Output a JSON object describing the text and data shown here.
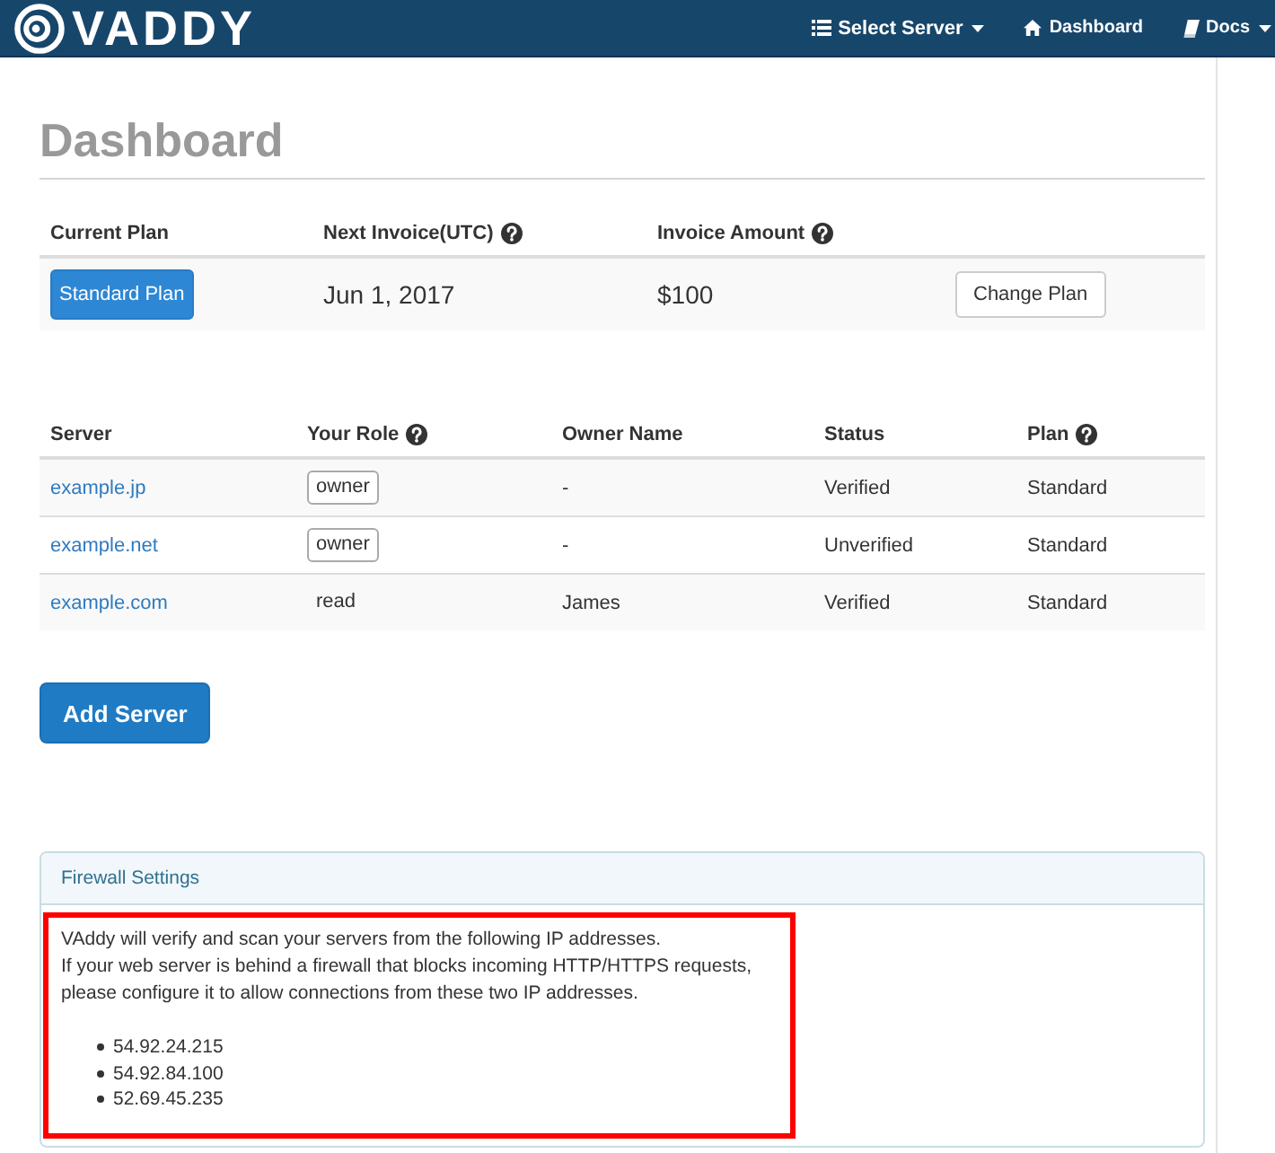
{
  "navbar": {
    "logo": "VADDY",
    "items": [
      {
        "label": "Select Server",
        "kind": "dropdown"
      },
      {
        "label": "Dashboard",
        "kind": "link"
      },
      {
        "label": "Docs",
        "kind": "dropdown"
      }
    ]
  },
  "page": {
    "title": "Dashboard"
  },
  "plan_table": {
    "columns": [
      {
        "label": "Current Plan",
        "help": false
      },
      {
        "label": "Next Invoice(UTC)",
        "help": true
      },
      {
        "label": "Invoice Amount",
        "help": true
      }
    ],
    "row": {
      "plan": "Standard Plan",
      "next_invoice": "Jun 1, 2017",
      "amount": "$100",
      "action": "Change Plan"
    }
  },
  "servers_table": {
    "columns": [
      {
        "label": "Server",
        "help": false
      },
      {
        "label": "Your Role",
        "help": true
      },
      {
        "label": "Owner Name",
        "help": false
      },
      {
        "label": "Status",
        "help": false
      },
      {
        "label": "Plan",
        "help": true
      }
    ],
    "rows": [
      {
        "server": "example.jp",
        "role": "owner",
        "role_boxed": true,
        "owner_name": "-",
        "status": "Verified",
        "plan": "Standard"
      },
      {
        "server": "example.net",
        "role": "owner",
        "role_boxed": true,
        "owner_name": "-",
        "status": "Unverified",
        "plan": "Standard"
      },
      {
        "server": "example.com",
        "role": "read",
        "role_boxed": false,
        "owner_name": "James",
        "status": "Verified",
        "plan": "Standard"
      }
    ]
  },
  "add_button": "Add Server",
  "firewall": {
    "title": "Firewall Settings",
    "highlighted": true,
    "message_lines": [
      "VAddy will verify and scan your servers from the following IP addresses.",
      "If your web server is behind a firewall that blocks incoming HTTP/HTTPS requests,",
      "please configure it to allow connections from these two IP addresses."
    ],
    "ip_addresses": [
      "54.92.24.215",
      "54.92.84.100",
      "52.69.45.235"
    ]
  }
}
